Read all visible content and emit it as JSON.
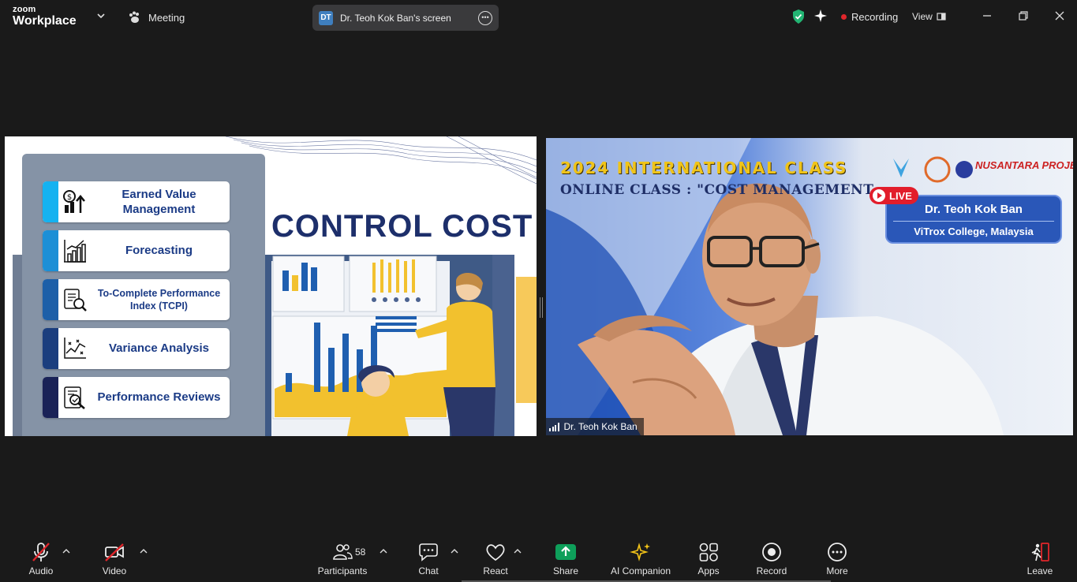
{
  "app": {
    "brand_line1": "zoom",
    "brand_line2": "Workplace",
    "meeting_label": "Meeting",
    "screen_initials": "DT",
    "screen_label": "Dr. Teoh Kok Ban's screen",
    "recording_label": "Recording",
    "view_label": "View"
  },
  "slide": {
    "title": "CONTROL COST",
    "items": [
      {
        "label": "Earned Value Management",
        "icon": "money-up-icon"
      },
      {
        "label": "Forecasting",
        "icon": "bar-growth-icon"
      },
      {
        "label": "To-Complete Performance Index (TCPI)",
        "icon": "report-search-icon"
      },
      {
        "label": "Variance Analysis",
        "icon": "scatter-chart-icon"
      },
      {
        "label": "Performance Reviews",
        "icon": "document-magnify-icon"
      }
    ]
  },
  "camera": {
    "banner_line1": "2024 INTERNATIONAL CLASS",
    "banner_line2": "ONLINE CLASS : \"COST MANAGEMENT",
    "live_label": "LIVE",
    "org_label": "NUSANTARA PROJECT",
    "speaker_name": "Dr. Teoh Kok Ban",
    "speaker_org": "ViTrox College, Malaysia",
    "participant_name": "Dr. Teoh Kok Ban"
  },
  "toolbar": {
    "audio": "Audio",
    "video": "Video",
    "participants": "Participants",
    "participants_count": "58",
    "chat": "Chat",
    "react": "React",
    "share": "Share",
    "ai_companion": "AI Companion",
    "apps": "Apps",
    "record": "Record",
    "more": "More",
    "leave": "Leave"
  },
  "colors": {
    "share_green": "#0e9f5a",
    "leave_red": "#e0262b",
    "ai_yellow": "#f5c518",
    "recording_dot": "#e0262b",
    "slide_title": "#1d2f6b"
  }
}
